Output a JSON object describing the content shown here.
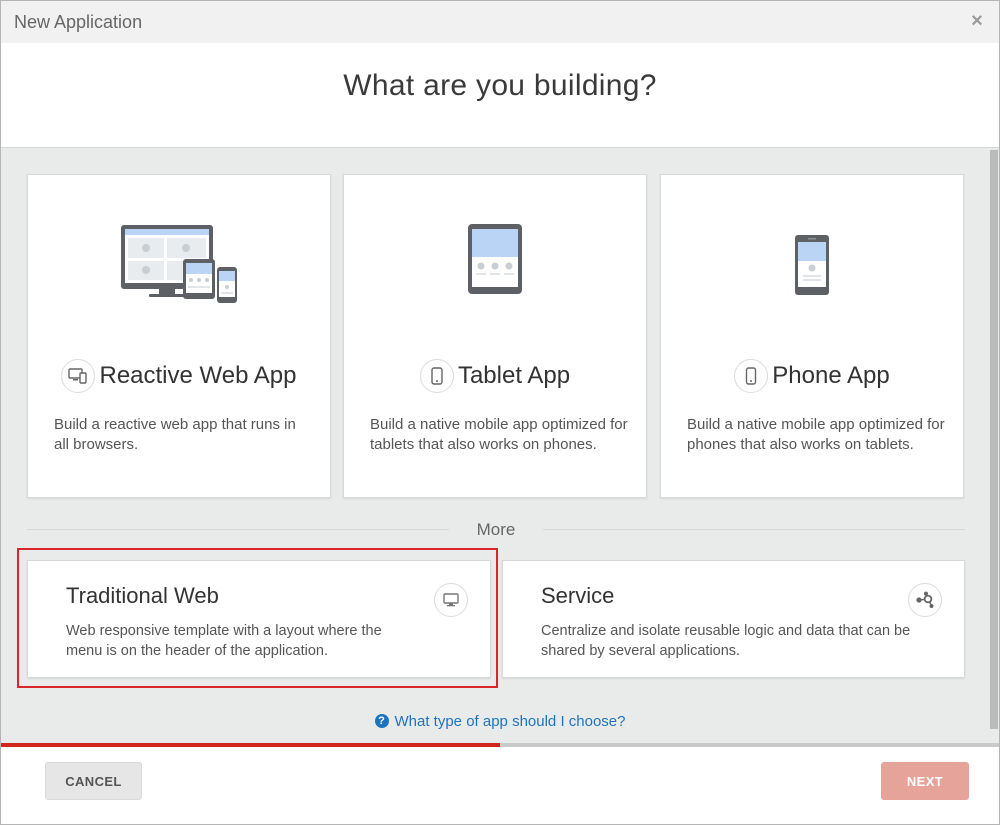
{
  "window": {
    "title": "New Application",
    "close_symbol": "×"
  },
  "heading": "What are you building?",
  "app_types": [
    {
      "name": "Reactive Web App",
      "icon": "devices-icon",
      "description": "Build a reactive web app that runs in all browsers."
    },
    {
      "name": "Tablet App",
      "icon": "tablet-icon",
      "description": "Build a native mobile app optimized for tablets that also works on phones."
    },
    {
      "name": "Phone App",
      "icon": "phone-icon",
      "description": "Build a native mobile app optimized for phones that also works on tablets."
    }
  ],
  "more_label": "More",
  "more_types": [
    {
      "name": "Traditional Web",
      "icon": "monitor-icon",
      "description": "Web responsive template with a layout where the menu is on the header of the application.",
      "selected": true
    },
    {
      "name": "Service",
      "icon": "service-nodes-icon",
      "description": "Centralize and isolate reusable logic and data that can be shared by several applications.",
      "selected": false
    }
  ],
  "help_link": {
    "icon_text": "?",
    "label": "What type of app should I choose?"
  },
  "progress": {
    "value": 0.5
  },
  "footer": {
    "cancel_label": "CANCEL",
    "next_label": "NEXT"
  },
  "colors": {
    "accent_red": "#d0271d",
    "selection_border": "#d9262c",
    "link_blue": "#1e73be",
    "next_disabled": "#e6a399",
    "content_bg": "#e9ebeb",
    "illustration_blue": "#b9d4f5",
    "illustration_dark": "#5d6166"
  }
}
